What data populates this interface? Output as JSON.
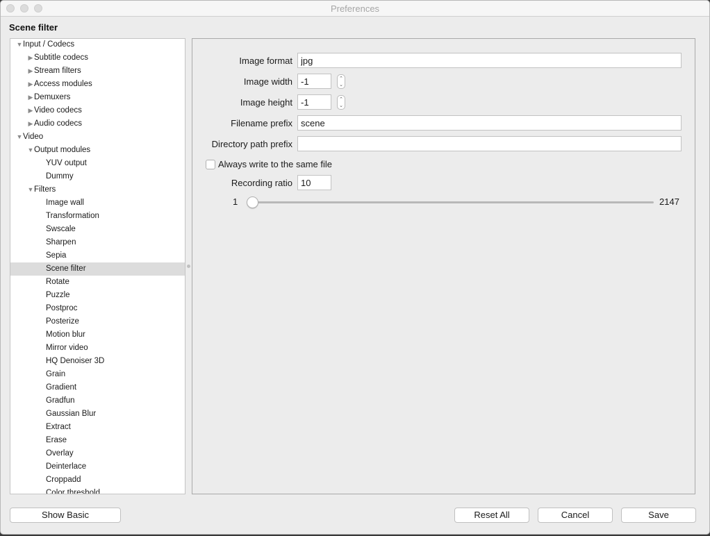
{
  "window": {
    "title": "Preferences"
  },
  "section_title": "Scene filter",
  "tree": {
    "selected_index": 17,
    "items": [
      {
        "label": "Input / Codecs",
        "depth": 0,
        "arrow": "down"
      },
      {
        "label": "Subtitle codecs",
        "depth": 1,
        "arrow": "right"
      },
      {
        "label": "Stream filters",
        "depth": 1,
        "arrow": "right"
      },
      {
        "label": "Access modules",
        "depth": 1,
        "arrow": "right"
      },
      {
        "label": "Demuxers",
        "depth": 1,
        "arrow": "right"
      },
      {
        "label": "Video codecs",
        "depth": 1,
        "arrow": "right"
      },
      {
        "label": "Audio codecs",
        "depth": 1,
        "arrow": "right"
      },
      {
        "label": "Video",
        "depth": 0,
        "arrow": "down"
      },
      {
        "label": "Output modules",
        "depth": 1,
        "arrow": "down"
      },
      {
        "label": "YUV output",
        "depth": 2,
        "arrow": ""
      },
      {
        "label": "Dummy",
        "depth": 2,
        "arrow": ""
      },
      {
        "label": "Filters",
        "depth": 1,
        "arrow": "down"
      },
      {
        "label": "Image wall",
        "depth": 2,
        "arrow": ""
      },
      {
        "label": "Transformation",
        "depth": 2,
        "arrow": ""
      },
      {
        "label": "Swscale",
        "depth": 2,
        "arrow": ""
      },
      {
        "label": "Sharpen",
        "depth": 2,
        "arrow": ""
      },
      {
        "label": "Sepia",
        "depth": 2,
        "arrow": ""
      },
      {
        "label": "Scene filter",
        "depth": 2,
        "arrow": ""
      },
      {
        "label": "Rotate",
        "depth": 2,
        "arrow": ""
      },
      {
        "label": "Puzzle",
        "depth": 2,
        "arrow": ""
      },
      {
        "label": "Postproc",
        "depth": 2,
        "arrow": ""
      },
      {
        "label": "Posterize",
        "depth": 2,
        "arrow": ""
      },
      {
        "label": "Motion blur",
        "depth": 2,
        "arrow": ""
      },
      {
        "label": "Mirror video",
        "depth": 2,
        "arrow": ""
      },
      {
        "label": "HQ Denoiser 3D",
        "depth": 2,
        "arrow": ""
      },
      {
        "label": "Grain",
        "depth": 2,
        "arrow": ""
      },
      {
        "label": "Gradient",
        "depth": 2,
        "arrow": ""
      },
      {
        "label": "Gradfun",
        "depth": 2,
        "arrow": ""
      },
      {
        "label": "Gaussian Blur",
        "depth": 2,
        "arrow": ""
      },
      {
        "label": "Extract",
        "depth": 2,
        "arrow": ""
      },
      {
        "label": "Erase",
        "depth": 2,
        "arrow": ""
      },
      {
        "label": "Overlay",
        "depth": 2,
        "arrow": ""
      },
      {
        "label": "Deinterlace",
        "depth": 2,
        "arrow": ""
      },
      {
        "label": "Croppadd",
        "depth": 2,
        "arrow": ""
      },
      {
        "label": "Color threshold",
        "depth": 2,
        "arrow": ""
      }
    ]
  },
  "form": {
    "image_format": {
      "label": "Image format",
      "value": "jpg"
    },
    "image_width": {
      "label": "Image width",
      "value": "-1"
    },
    "image_height": {
      "label": "Image height",
      "value": "-1"
    },
    "filename_prefix": {
      "label": "Filename prefix",
      "value": "scene"
    },
    "directory_path_prefix": {
      "label": "Directory path prefix",
      "value": ""
    },
    "always_write_same_file": {
      "label": "Always write to the same file",
      "checked": false
    },
    "recording_ratio": {
      "label": "Recording ratio",
      "value": "10"
    },
    "slider": {
      "min_label": "1",
      "max_label": "2147",
      "min": 1,
      "max": 2147,
      "value": 1
    }
  },
  "buttons": {
    "show_basic": "Show Basic",
    "reset_all": "Reset All",
    "cancel": "Cancel",
    "save": "Save"
  },
  "icons": {
    "expanded": "▼",
    "collapsed": "▶",
    "step_up": "⌃",
    "step_down": "⌄"
  }
}
